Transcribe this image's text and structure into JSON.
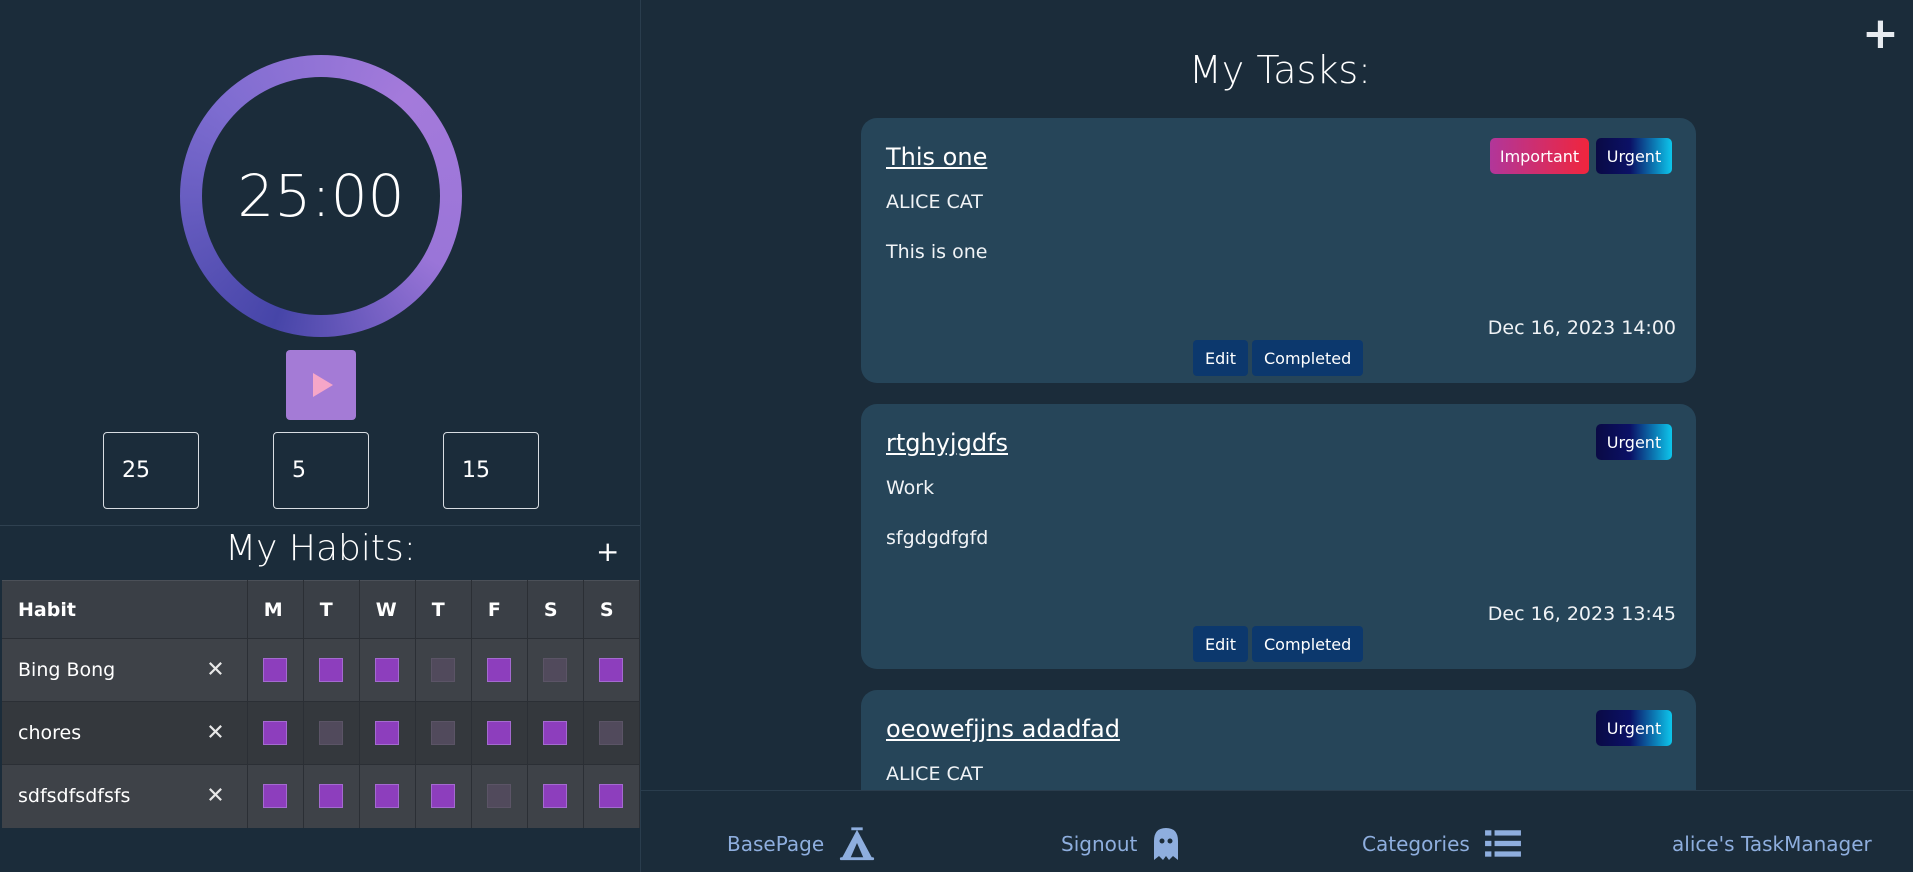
{
  "pomodoro": {
    "time": "25:00",
    "work_minutes": "25",
    "short_break": "5",
    "long_break": "15"
  },
  "habits": {
    "title": "My Habits:",
    "add_label": "+",
    "header": {
      "habit": "Habit",
      "days": [
        "M",
        "T",
        "W",
        "T",
        "F",
        "S",
        "S"
      ]
    },
    "rows": [
      {
        "name": "Bing Bong",
        "days": [
          true,
          true,
          true,
          false,
          true,
          false,
          true
        ]
      },
      {
        "name": "chores",
        "days": [
          true,
          false,
          true,
          false,
          true,
          true,
          false
        ]
      },
      {
        "name": "sdfsdfsdfsfs",
        "days": [
          true,
          true,
          true,
          true,
          false,
          true,
          true
        ]
      }
    ],
    "delete_label": "✕"
  },
  "tasks": {
    "title": "My Tasks:",
    "add_label": "+",
    "items": [
      {
        "name": "This one",
        "category": "ALICE CAT",
        "description": "This is one",
        "date": "Dec 16, 2023 14:00",
        "important_label": "Important",
        "urgent_label": "Urgent"
      },
      {
        "name": "rtghyjgdfs",
        "category": "Work",
        "description": "sfgdgdfgfd",
        "date": "Dec 16, 2023 13:45",
        "urgent_label": "Urgent"
      },
      {
        "name": "oeowefjjns adadfad",
        "category": "ALICE CAT",
        "urgent_label": "Urgent"
      }
    ],
    "edit_label": "Edit",
    "completed_label": "Completed"
  },
  "footer": {
    "base_page": "BasePage",
    "signout": "Signout",
    "categories": "Categories",
    "app_name": "alice's TaskManager"
  },
  "colors": {
    "background": "#1b2c3a",
    "card": "#264559",
    "habit_on": "#8d3ebd",
    "nav_text": "#8eaede"
  }
}
